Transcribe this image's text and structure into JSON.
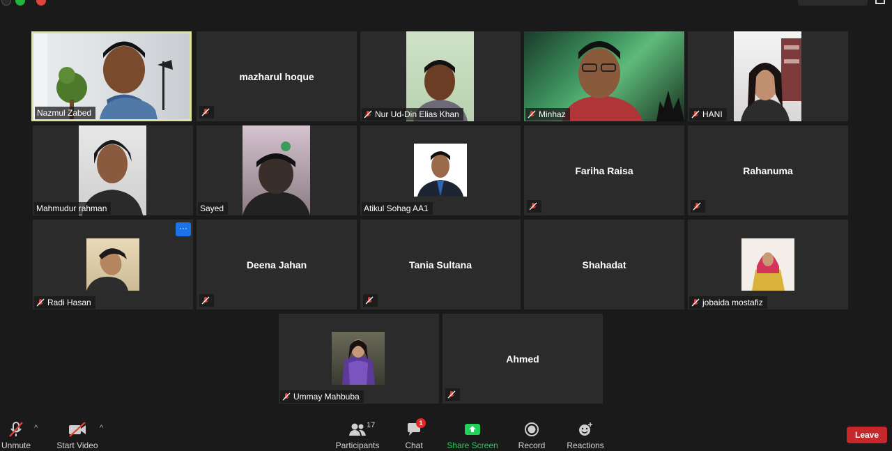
{
  "toolbar": {
    "unmute": "Unmute",
    "start_video": "Start Video",
    "participants": "Participants",
    "participant_count": "17",
    "chat": "Chat",
    "chat_unread": "1",
    "share_screen": "Share Screen",
    "record": "Record",
    "reactions": "Reactions",
    "leave": "Leave"
  },
  "participants": [
    {
      "name": "Nazmul Zabed",
      "video": true,
      "muted": false,
      "active_speaker": true
    },
    {
      "name": "mazharul hoque",
      "video": false,
      "muted": true
    },
    {
      "name": "Nur Ud-Din Elias Khan",
      "video": true,
      "muted": true
    },
    {
      "name": "Minhaz",
      "video": true,
      "muted": true
    },
    {
      "name": "HANI",
      "video": true,
      "muted": true
    },
    {
      "name": "Mahmudur rahman",
      "video": true,
      "muted": false
    },
    {
      "name": "Sayed",
      "video": true,
      "muted": false
    },
    {
      "name": "Atikul Sohag AA1",
      "video": true,
      "muted": false
    },
    {
      "name": "Fariha Raisa",
      "video": false,
      "muted": true
    },
    {
      "name": "Rahanuma",
      "video": false,
      "muted": true
    },
    {
      "name": "Radi Hasan",
      "video": true,
      "muted": true,
      "more_options": "···"
    },
    {
      "name": "Deena Jahan",
      "video": false,
      "muted": true
    },
    {
      "name": "Tania Sultana",
      "video": false,
      "muted": true
    },
    {
      "name": "Shahadat",
      "video": false,
      "muted": false
    },
    {
      "name": "jobaida mostafiz",
      "video": true,
      "muted": true
    },
    {
      "name": "Ummay Mahbuba",
      "video": true,
      "muted": true
    },
    {
      "name": "Ahmed",
      "video": false,
      "muted": true
    }
  ],
  "colors": {
    "background": "#1a1a1a",
    "tile": "#2b2b2b",
    "active_speaker_border": "#dde39a",
    "share_green": "#24d05c",
    "leave_red": "#c6272b",
    "muted_red": "#e0443a"
  }
}
